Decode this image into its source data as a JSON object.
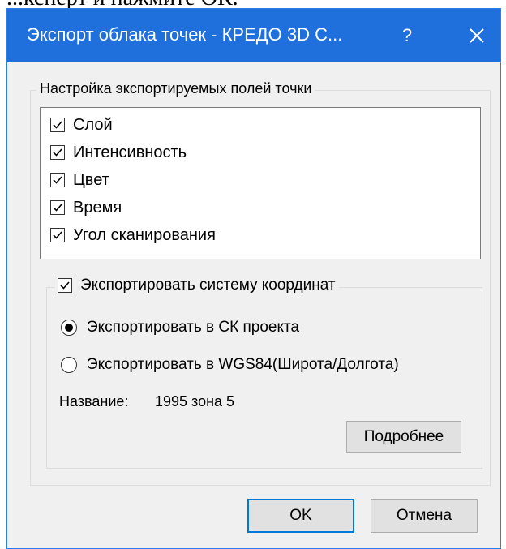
{
  "background_text": "...ксперт и нажмите ОК.",
  "titlebar": {
    "title": "Экспорт облака точек - КРЕДО 3D С...",
    "help_label": "?"
  },
  "fields_group": {
    "legend": "Настройка экспортируемых полей точки",
    "items": [
      {
        "label": "Слой",
        "checked": true
      },
      {
        "label": "Интенсивность",
        "checked": true
      },
      {
        "label": "Цвет",
        "checked": true
      },
      {
        "label": "Время",
        "checked": true
      },
      {
        "label": "Угол сканирования",
        "checked": true
      }
    ]
  },
  "coord_group": {
    "legend_checkbox": {
      "label": "Экспортировать систему координат",
      "checked": true
    },
    "options": [
      {
        "label": "Экспортировать в СК проекта",
        "selected": true
      },
      {
        "label": "Экспортировать в WGS84(Широта/Долгота)",
        "selected": false
      }
    ],
    "name_label": "Название:",
    "name_value": "1995 зона 5",
    "details_button": "Подробнее"
  },
  "footer": {
    "ok_label": "OK",
    "cancel_label": "Отмена"
  },
  "colors": {
    "titlebar": "#1f6fdc",
    "dialog_bg": "#f0f0f0",
    "accent_border": "#0078d7"
  }
}
